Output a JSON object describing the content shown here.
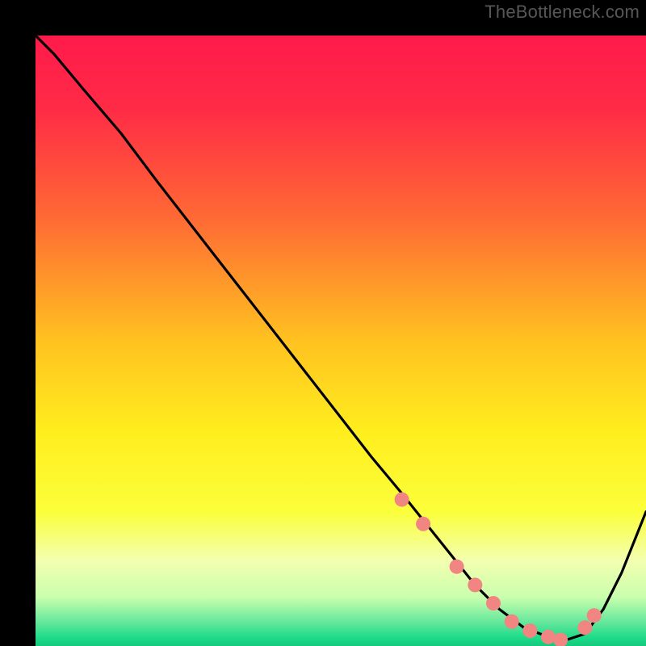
{
  "watermark": "TheBottleneck.com",
  "chart_data": {
    "type": "line",
    "title": "",
    "xlabel": "",
    "ylabel": "",
    "xlim": [
      0,
      100
    ],
    "ylim": [
      0,
      100
    ],
    "gradient_stops": [
      {
        "offset": 0.0,
        "color": "#ff1a4b"
      },
      {
        "offset": 0.12,
        "color": "#ff2b46"
      },
      {
        "offset": 0.3,
        "color": "#ff6a34"
      },
      {
        "offset": 0.5,
        "color": "#ffc220"
      },
      {
        "offset": 0.65,
        "color": "#ffee1e"
      },
      {
        "offset": 0.78,
        "color": "#fbff3a"
      },
      {
        "offset": 0.86,
        "color": "#f3ffb0"
      },
      {
        "offset": 0.92,
        "color": "#c9ffad"
      },
      {
        "offset": 0.965,
        "color": "#5be59a"
      },
      {
        "offset": 0.985,
        "color": "#1fdc8a"
      },
      {
        "offset": 1.0,
        "color": "#13c97d"
      }
    ],
    "curve": {
      "x": [
        0,
        3,
        8,
        14,
        20,
        27,
        34,
        41,
        48,
        55,
        60,
        64,
        68,
        72,
        76,
        80,
        84,
        87,
        90,
        93,
        96,
        100
      ],
      "y": [
        100,
        97,
        91,
        84,
        76,
        67,
        58,
        49,
        40,
        31,
        25,
        20,
        15,
        10,
        6,
        3,
        1.5,
        1,
        2,
        6,
        12,
        22
      ]
    },
    "markers": {
      "x": [
        60,
        63.5,
        69,
        72,
        75,
        78,
        81,
        84,
        86,
        90,
        91.5
      ],
      "y": [
        24,
        20,
        13,
        10,
        7,
        4,
        2.5,
        1.5,
        1,
        3,
        5
      ]
    },
    "marker_style": {
      "radius": 9,
      "fill": "#f08582"
    }
  }
}
